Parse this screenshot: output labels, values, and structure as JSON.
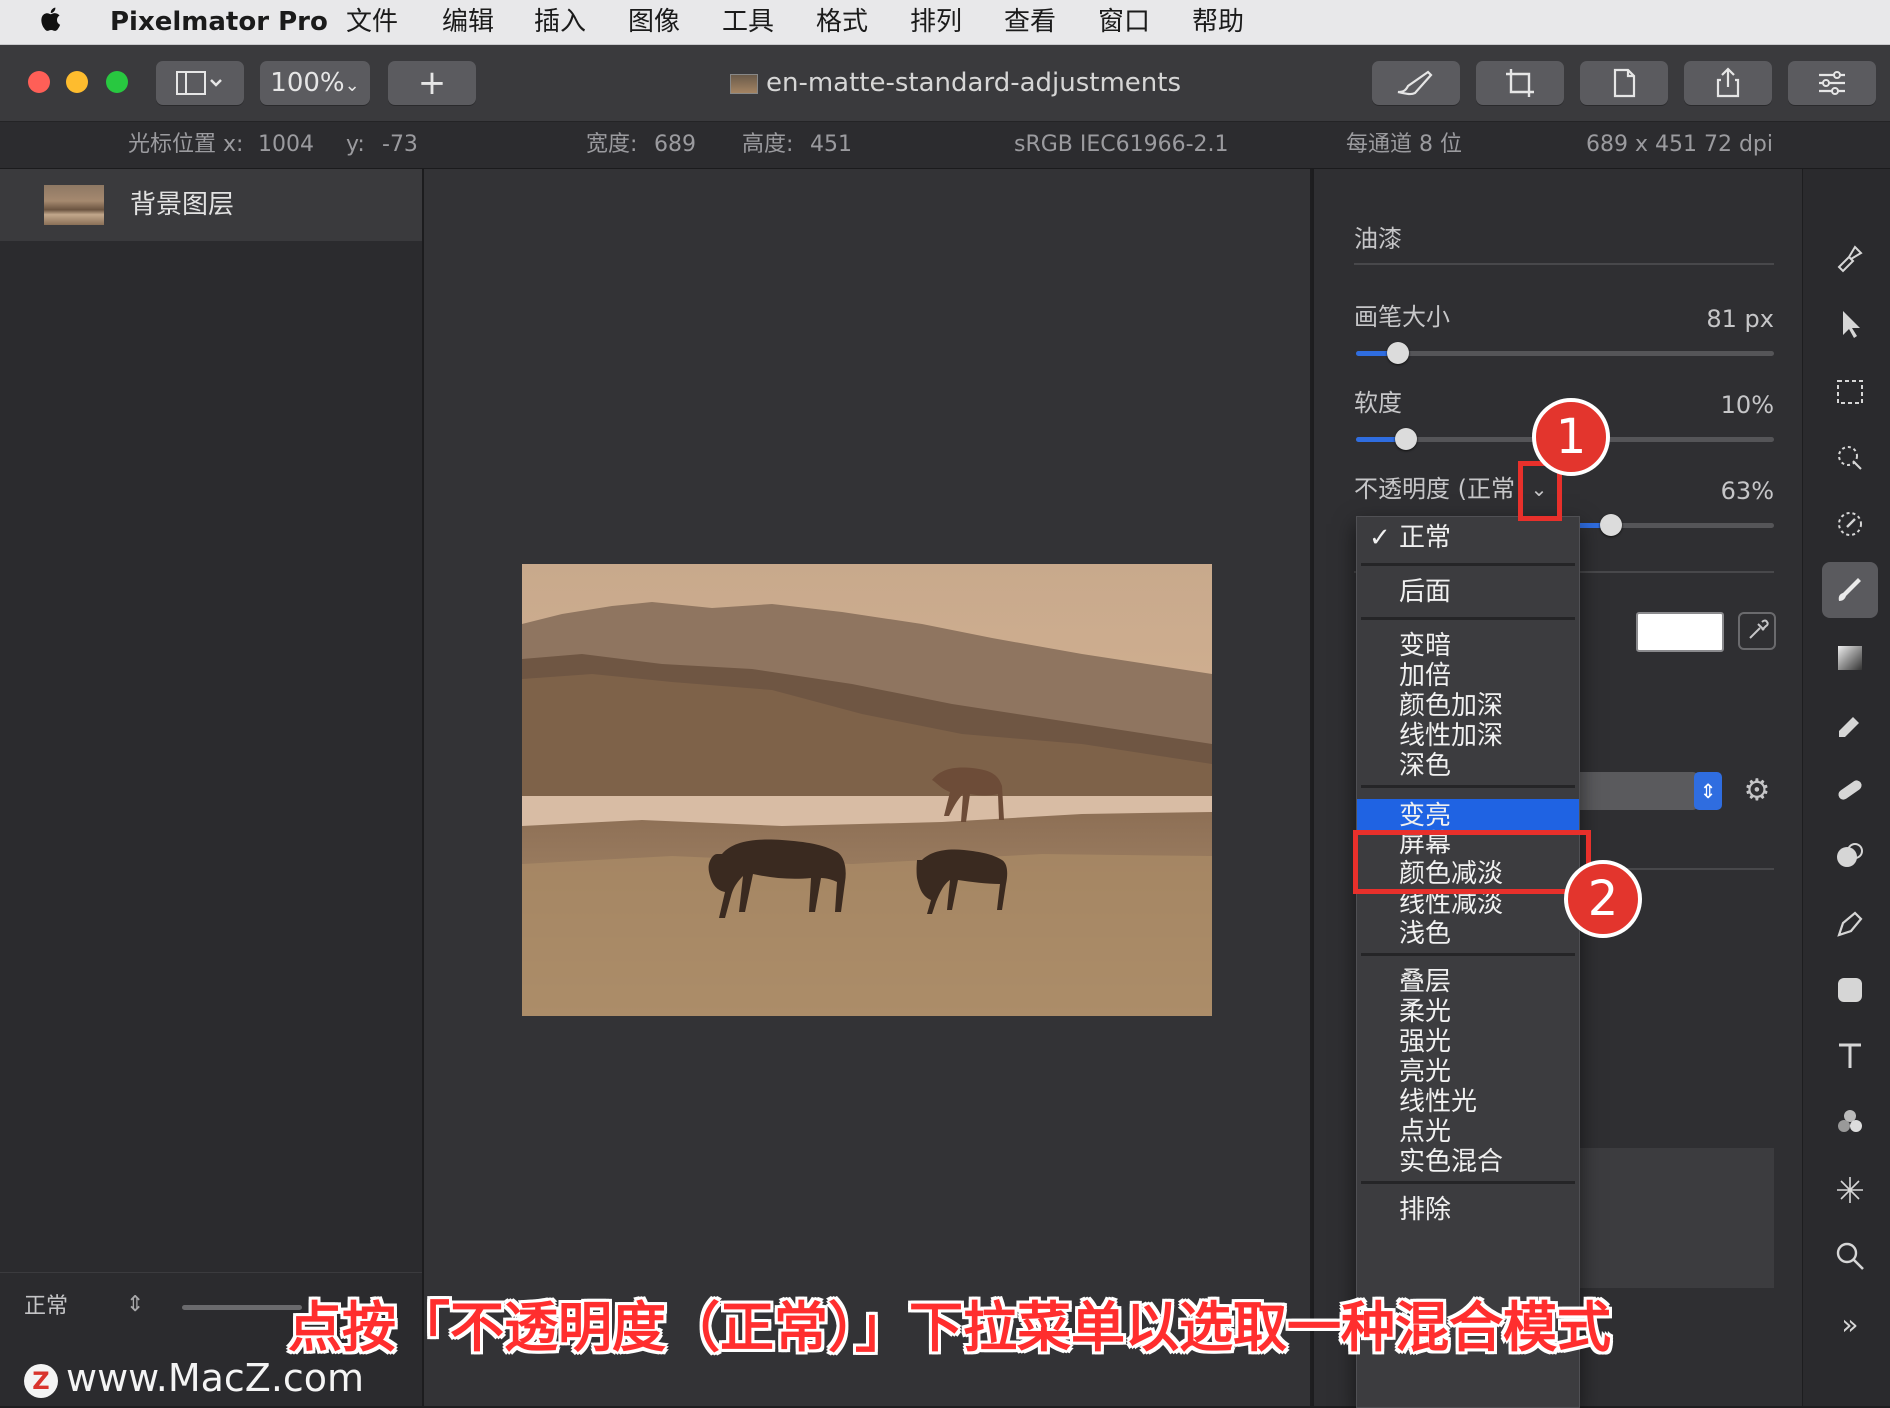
{
  "menubar": {
    "app_name": "Pixelmator Pro",
    "items": [
      "文件",
      "编辑",
      "插入",
      "图像",
      "工具",
      "格式",
      "排列",
      "查看",
      "窗口",
      "帮助"
    ]
  },
  "window": {
    "zoom": "100%",
    "add_label": "+",
    "document_title": "en-matte-standard-adjustments"
  },
  "infobar": {
    "cursor_x_label": "光标位置 x:",
    "cursor_x": "1004",
    "cursor_y_label": "y:",
    "cursor_y": "-73",
    "width_label": "宽度:",
    "width": "689",
    "height_label": "高度:",
    "height": "451",
    "color_profile": "sRGB IEC61966-2.1",
    "bit_depth": "每通道 8 位",
    "dimensions": "689 x 451 72 dpi"
  },
  "layers": {
    "items": [
      {
        "name": "背景图层"
      }
    ],
    "footer_blend": "正常"
  },
  "panel": {
    "tool_name": "油漆",
    "brush_size": {
      "label": "画笔大小",
      "value": "81 px",
      "fraction": 0.1
    },
    "softness": {
      "label": "软度",
      "value": "10%",
      "fraction": 0.12
    },
    "opacity": {
      "label": "不透明度 (正常",
      "value": "63%",
      "fraction": 0.61
    },
    "color_swatch": "#ffffff"
  },
  "blend_menu": {
    "selected": "正常",
    "highlighted": "变亮",
    "groups": [
      [
        "正常"
      ],
      [
        "后面"
      ],
      [
        "变暗",
        "加倍",
        "颜色加深",
        "线性加深",
        "深色"
      ],
      [
        "变亮",
        "屏幕",
        "颜色减淡",
        "线性减淡",
        "浅色"
      ],
      [
        "叠层",
        "柔光",
        "强光",
        "亮光",
        "线性光",
        "点光",
        "实色混合"
      ],
      [
        "排除"
      ]
    ]
  },
  "annotations": {
    "badge_1": "1",
    "badge_2": "2",
    "caption": "点按「不透明度（正常）」下拉菜单以选取一种混合模式",
    "watermark": "www.MacZ.com",
    "accent_color": "#e3352d"
  },
  "colors": {
    "selection_blue": "#1f63e3",
    "slider_blue": "#2f6de0"
  }
}
